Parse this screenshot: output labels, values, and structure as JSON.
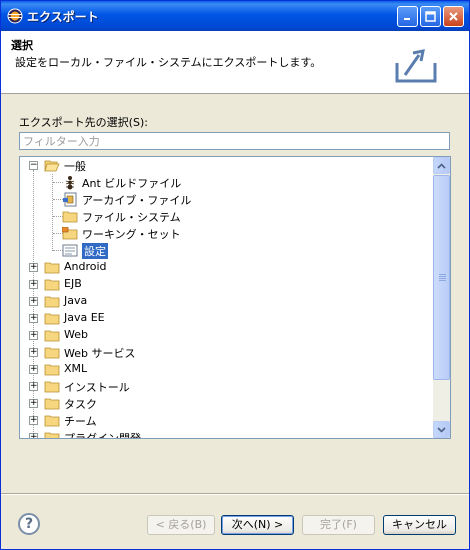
{
  "window": {
    "title": "エクスポート"
  },
  "header": {
    "title": "選択",
    "description": "設定をローカル・ファイル・システムにエクスポートします。"
  },
  "destination": {
    "label": "エクスポート先の選択(S):",
    "filter_placeholder": "フィルター入力"
  },
  "tree": {
    "items": [
      {
        "label": "一般",
        "level": 0,
        "expanded": true,
        "icon": "folder-open-icon"
      },
      {
        "label": "Ant ビルドファイル",
        "level": 1,
        "icon": "ant-icon"
      },
      {
        "label": "アーカイブ・ファイル",
        "level": 1,
        "icon": "archive-icon"
      },
      {
        "label": "ファイル・システム",
        "level": 1,
        "icon": "folder-icon"
      },
      {
        "label": "ワーキング・セット",
        "level": 1,
        "icon": "working-set-icon"
      },
      {
        "label": "設定",
        "level": 1,
        "icon": "preferences-icon",
        "selected": true
      },
      {
        "label": "Android",
        "level": 0,
        "expanded": false,
        "icon": "folder-icon"
      },
      {
        "label": "EJB",
        "level": 0,
        "expanded": false,
        "icon": "folder-icon"
      },
      {
        "label": "Java",
        "level": 0,
        "expanded": false,
        "icon": "folder-icon"
      },
      {
        "label": "Java EE",
        "level": 0,
        "expanded": false,
        "icon": "folder-icon"
      },
      {
        "label": "Web",
        "level": 0,
        "expanded": false,
        "icon": "folder-icon"
      },
      {
        "label": "Web サービス",
        "level": 0,
        "expanded": false,
        "icon": "folder-icon"
      },
      {
        "label": "XML",
        "level": 0,
        "expanded": false,
        "icon": "folder-icon"
      },
      {
        "label": "インストール",
        "level": 0,
        "expanded": false,
        "icon": "folder-icon"
      },
      {
        "label": "タスク",
        "level": 0,
        "expanded": false,
        "icon": "folder-icon"
      },
      {
        "label": "チーム",
        "level": 0,
        "expanded": false,
        "icon": "folder-icon"
      },
      {
        "label": "プラグイン開発",
        "level": 0,
        "expanded": false,
        "icon": "folder-icon"
      }
    ]
  },
  "footer": {
    "back": "< 戻る(B)",
    "next": "次へ(N) >",
    "finish": "完了(F)",
    "cancel": "キャンセル"
  },
  "colors": {
    "title_bar": "#0055e5",
    "selection": "#316ac5",
    "dialog_bg": "#ece9d8"
  }
}
